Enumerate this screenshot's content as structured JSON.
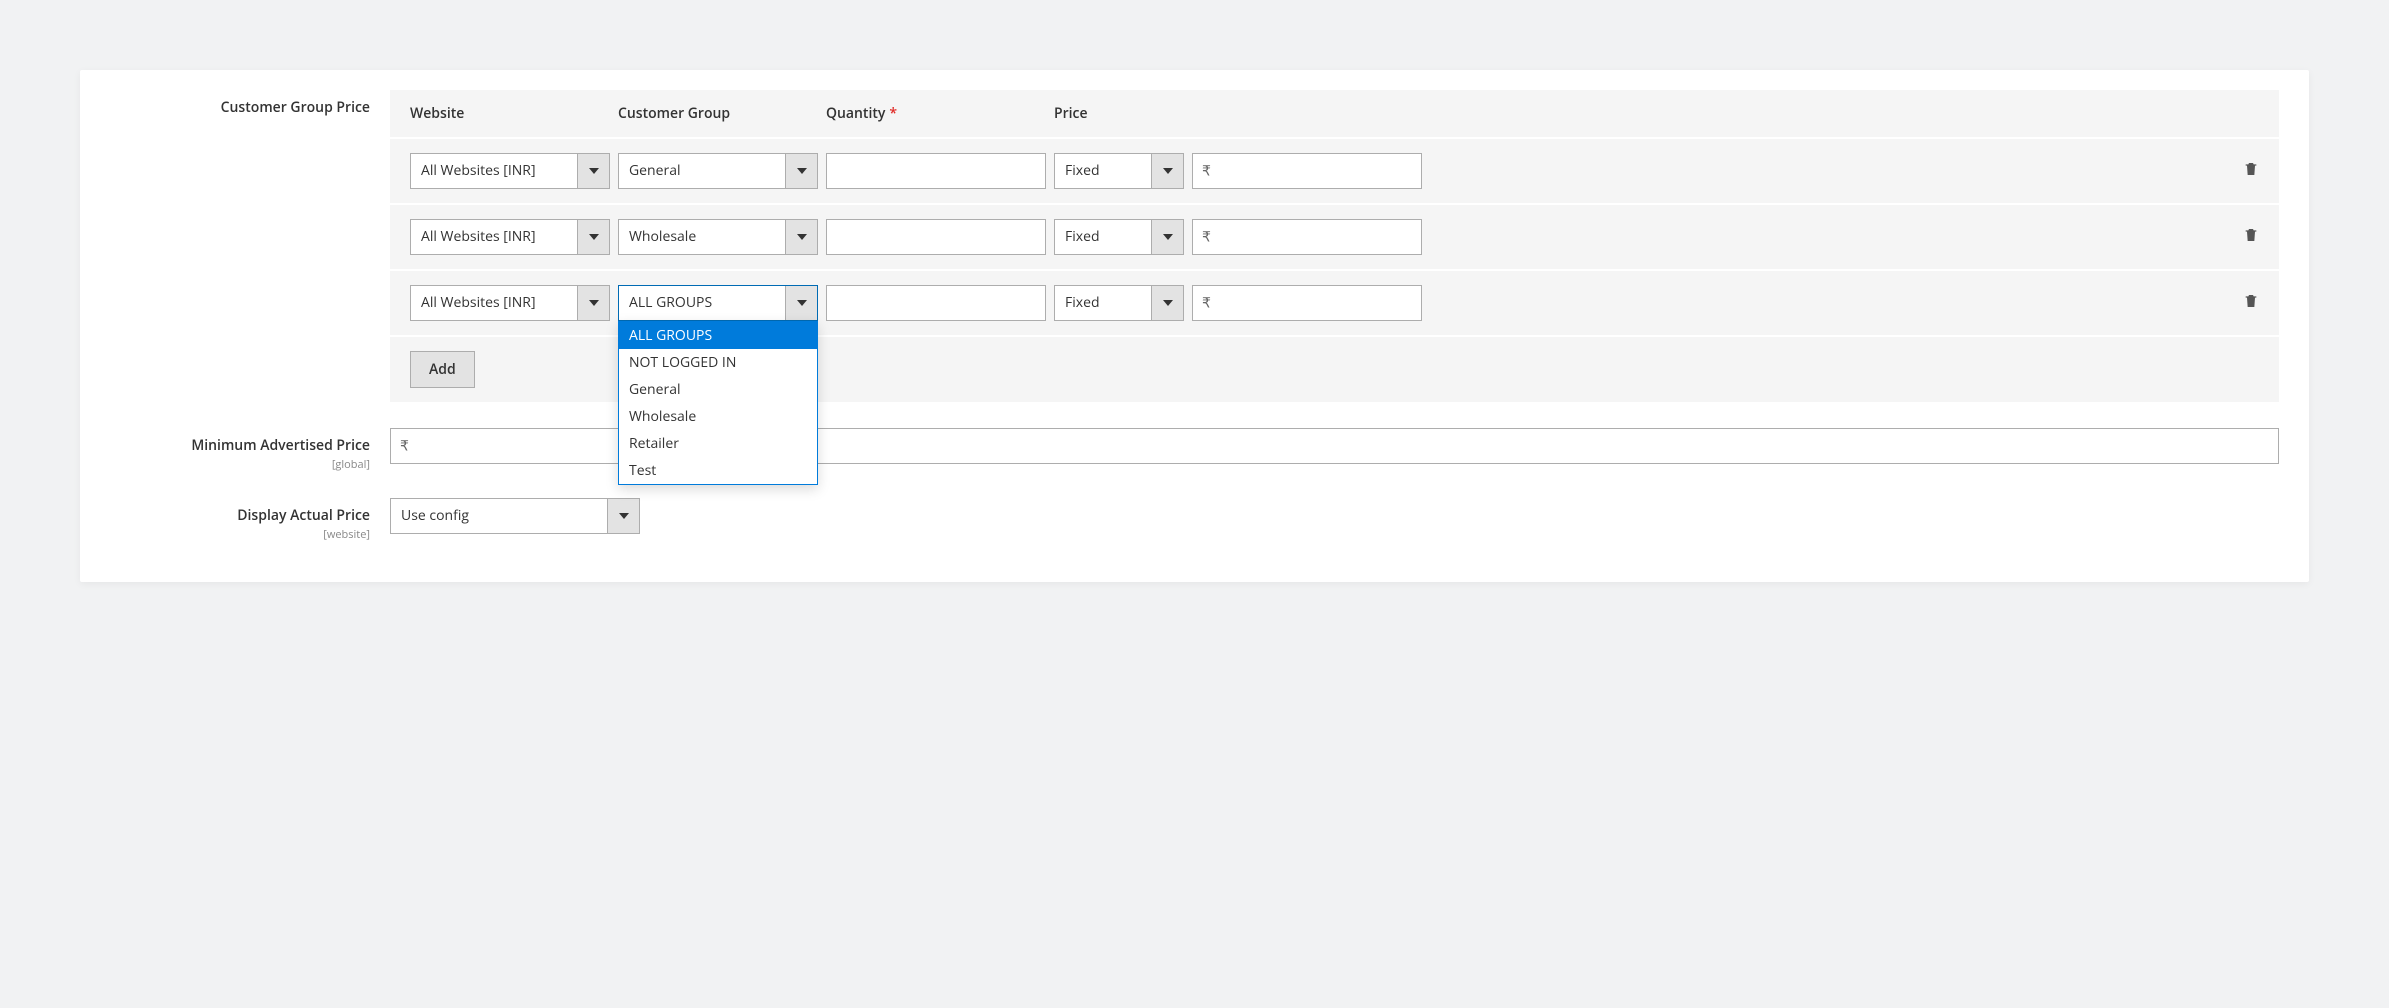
{
  "labels": {
    "customer_group_price": "Customer Group Price",
    "min_adv_price": "Minimum Advertised Price",
    "min_adv_price_scope": "[global]",
    "display_actual_price": "Display Actual Price",
    "display_actual_price_scope": "[website]"
  },
  "headers": {
    "website": "Website",
    "customer_group": "Customer Group",
    "quantity": "Quantity",
    "price": "Price"
  },
  "rows": [
    {
      "website": "All Websites [INR]",
      "group": "General",
      "pricetype": "Fixed",
      "currency": "₹",
      "qty": "",
      "price": ""
    },
    {
      "website": "All Websites [INR]",
      "group": "Wholesale",
      "pricetype": "Fixed",
      "currency": "₹",
      "qty": "",
      "price": ""
    },
    {
      "website": "All Websites [INR]",
      "group": "ALL GROUPS",
      "pricetype": "Fixed",
      "currency": "₹",
      "qty": "",
      "price": ""
    }
  ],
  "dropdown_options": [
    "ALL GROUPS",
    "NOT LOGGED IN",
    "General",
    "Wholesale",
    "Retailer",
    "Test"
  ],
  "add_button": "Add",
  "min_adv_currency": "₹",
  "min_adv_value": "",
  "display_actual_price_value": "Use config"
}
